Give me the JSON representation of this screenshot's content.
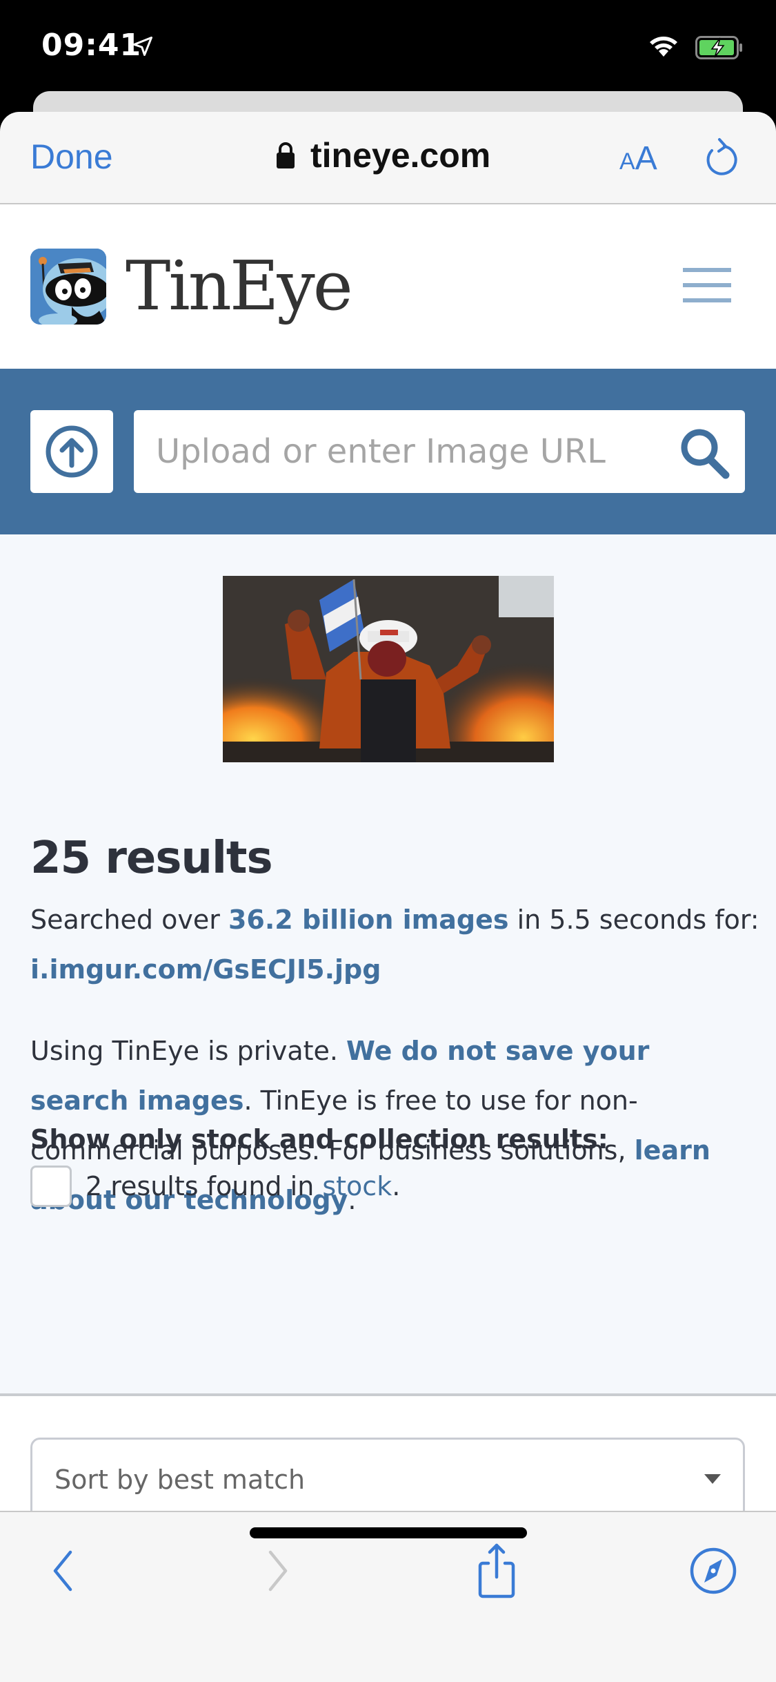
{
  "status_bar": {
    "time": "09:41",
    "icons": [
      "location-arrow-icon",
      "wifi-icon",
      "battery-charging-icon"
    ]
  },
  "browser": {
    "done_label": "Done",
    "url": "tineye.com",
    "text_size_small": "A",
    "text_size_big": "A",
    "accent_color": "#3a7bd5",
    "icons": [
      "lock-icon",
      "reload-icon"
    ]
  },
  "site": {
    "logo_text": "TinEye",
    "brand_color": "#41709e",
    "menu_icon": "hamburger-icon"
  },
  "search": {
    "placeholder": "Upload or enter Image URL",
    "value": "",
    "upload_icon": "upload-arrow-icon",
    "search_icon": "search-icon"
  },
  "query_image": {
    "alt": "Protester with flag in front of fire"
  },
  "results": {
    "title": "25 results",
    "searched_prefix": "Searched over ",
    "searched_link": "36.2 billion images",
    "searched_suffix": " in 5.5 seconds for:",
    "query_url": "i.imgur.com/GsECJI5.jpg"
  },
  "privacy": {
    "text1": "Using TinEye is private. ",
    "link1": "We do not save your search images",
    "text2": ". TinEye is free to use for non-commercial purposes. For business solutions, ",
    "link2": "learn about our technology",
    "text3": "."
  },
  "filter": {
    "label": "Show only stock and collection results:",
    "checkbox_checked": false,
    "stock_prefix": "2 results found in ",
    "stock_link": "stock",
    "stock_suffix": "."
  },
  "sort": {
    "selected": "Sort by best match"
  },
  "toolbar": {
    "items": [
      "back-icon",
      "forward-icon",
      "share-icon",
      "safari-compass-icon"
    ],
    "forward_enabled": false
  }
}
